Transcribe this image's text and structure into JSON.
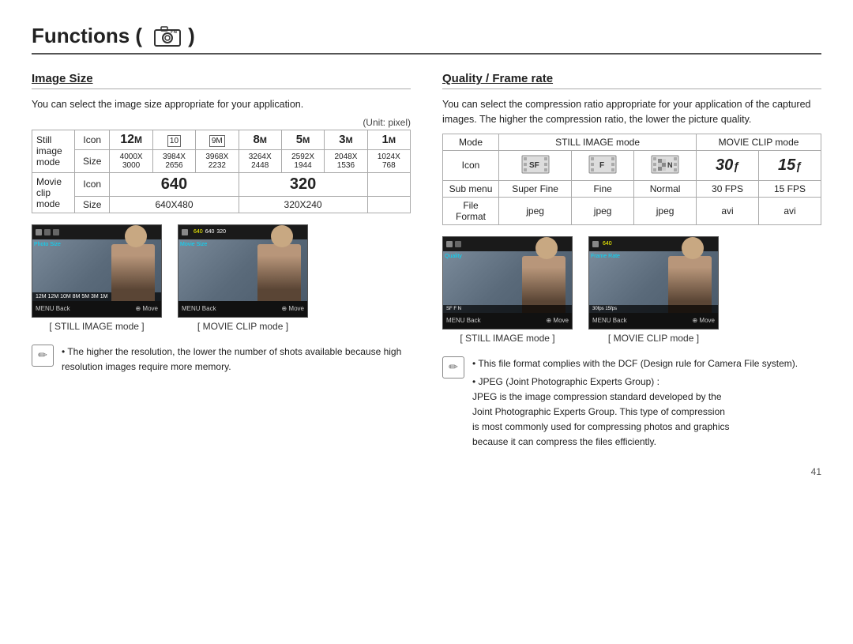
{
  "page": {
    "title": "Functions (",
    "title_suffix": ")",
    "page_number": "41"
  },
  "image_size": {
    "section_title": "Image Size",
    "description": "You can select the image size appropriate for your application.",
    "unit_note": "(Unit: pixel)",
    "table": {
      "rows": [
        {
          "mode_label": "Still",
          "mode_sub": "image",
          "mode_sub2": "mode",
          "type": "Icon",
          "values": [
            "12M",
            "10M",
            "9M",
            "8M",
            "5M",
            "3M",
            "1M"
          ]
        },
        {
          "type": "Size",
          "values": [
            "4000X\n3000",
            "3984X\n2656",
            "3968X\n2232",
            "3264X\n2448",
            "2592X\n1944",
            "2048X\n1536",
            "1024X\n768"
          ]
        },
        {
          "mode_label": "Movie",
          "mode_sub": "clip",
          "mode_sub2": "mode",
          "type": "Icon",
          "values_bold": [
            "640",
            "",
            "",
            "320",
            "",
            ""
          ]
        },
        {
          "type": "Size",
          "values_text": [
            "640X480",
            "",
            "",
            "320X240",
            "",
            ""
          ]
        }
      ]
    },
    "screenshots": [
      {
        "label": "[ STILL IMAGE mode ]"
      },
      {
        "label": "[ MOVIE CLIP mode ]"
      }
    ],
    "note": "The higher the resolution, the lower the number of shots available because high resolution images require more memory."
  },
  "quality": {
    "section_title": "Quality / Frame rate",
    "description": "You can select the compression ratio appropriate for your application of the captured images. The higher the compression ratio, the lower the picture quality.",
    "table": {
      "headers": [
        "Mode",
        "STILL IMAGE mode",
        "STILL IMAGE mode",
        "STILL IMAGE mode",
        "MOVIE CLIP mode",
        "MOVIE CLIP mode"
      ],
      "col_labels": [
        "Mode",
        "STILL IMAGE mode",
        "MOVIE CLIP mode"
      ],
      "rows": [
        {
          "label": "Icon",
          "values": [
            "SF_icon",
            "F_icon",
            "N_icon",
            "30fps_icon",
            "15fps_icon"
          ]
        },
        {
          "label": "Sub menu",
          "values": [
            "Super Fine",
            "Fine",
            "Normal",
            "30 FPS",
            "15 FPS"
          ]
        },
        {
          "label": "File\nFormat",
          "values": [
            "jpeg",
            "jpeg",
            "jpeg",
            "avi",
            "avi"
          ]
        }
      ]
    },
    "screenshots": [
      {
        "label": "[ STILL IMAGE mode ]"
      },
      {
        "label": "[ MOVIE CLIP mode ]"
      }
    ],
    "notes": [
      "This file format complies with the DCF (Design rule for Camera File system).",
      "JPEG (Joint Photographic Experts Group) :\nJPEG is the image compression standard developed by the Joint Photographic Experts Group. This type of compression is most commonly used for compressing photos and graphics because it can compress the files efficiently."
    ]
  }
}
